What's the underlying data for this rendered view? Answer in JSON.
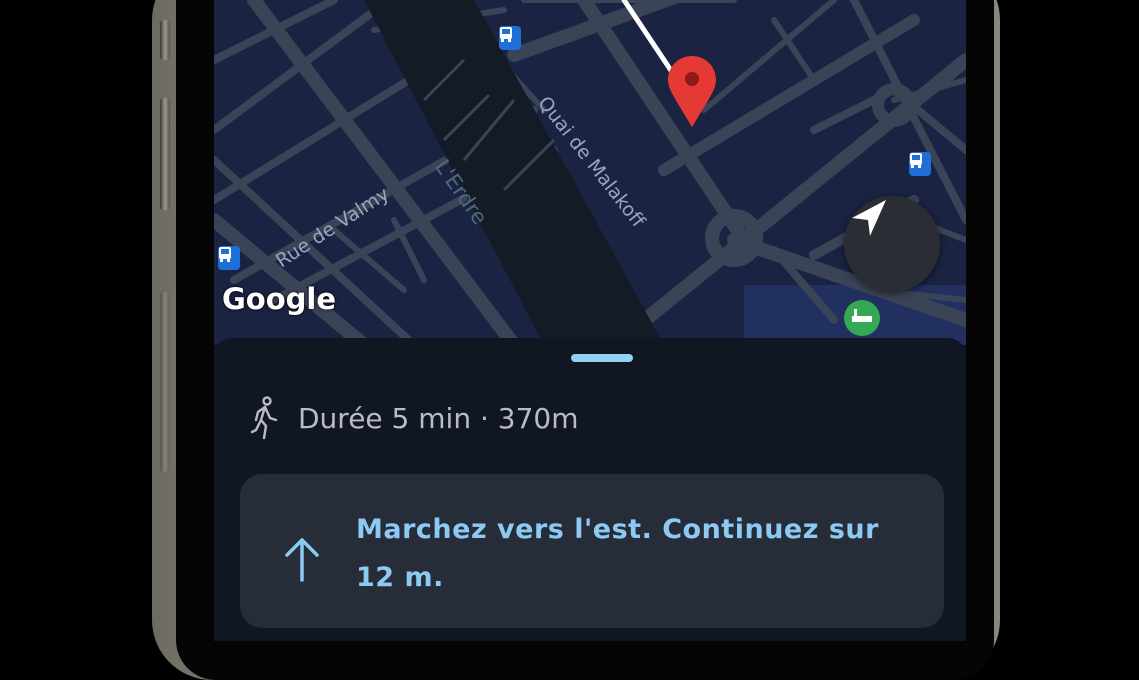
{
  "map": {
    "labels": {
      "quai": "Quai de Malakoff",
      "river": "L'Erdre",
      "rue": "Rue de Valmy"
    },
    "logo": "Google",
    "icons": {
      "destination": "map-pin-icon",
      "bus": "bus-stop-icon",
      "locate": "navigation-arrow-icon",
      "poi": "park-bench-icon"
    },
    "colors": {
      "background": "#1a2341",
      "roads": "#3b4457",
      "river": "#141a26",
      "pin": "#e53935",
      "route": "#ffffff",
      "bus": "#1f6fd8",
      "poi": "#34a853"
    }
  },
  "sheet": {
    "summary": "Durée 5 min · 370m",
    "summary_icon": "walking-person-icon",
    "instruction": {
      "text": "Marchez vers l'est. Continuez sur 12 m.",
      "icon": "arrow-up-icon",
      "color": "#8ccaf4"
    },
    "handle_color": "#8fd3f0"
  }
}
